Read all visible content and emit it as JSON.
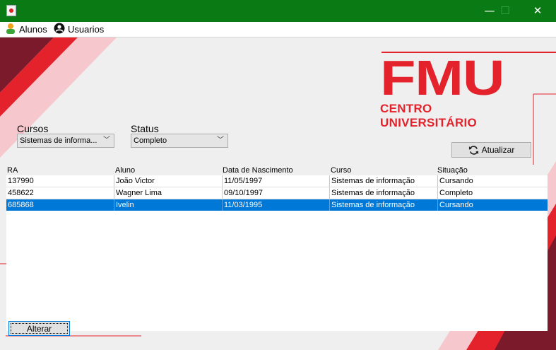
{
  "window": {
    "title": "",
    "controls": {
      "minimize": "—",
      "maximize": "☐",
      "close": "✕"
    }
  },
  "menu": {
    "items": [
      {
        "label": "Alunos",
        "icon": "student-icon"
      },
      {
        "label": "Usuarios",
        "icon": "user-circle-icon"
      }
    ]
  },
  "logo": {
    "main": "FMU",
    "sub": "CENTRO UNIVERSITÁRIO"
  },
  "filters": {
    "cursos": {
      "label": "Cursos",
      "value": "Sistemas de informa..."
    },
    "status": {
      "label": "Status",
      "value": "Completo"
    }
  },
  "buttons": {
    "refresh": "Atualizar",
    "edit": "Alterar"
  },
  "table": {
    "columns": [
      "RA",
      "Aluno",
      "Data de Nascimento",
      "Curso",
      "Situação"
    ],
    "rows": [
      [
        "137990",
        "João Victor",
        "11/05/1997",
        "Sistemas de informação",
        "Cursando"
      ],
      [
        "458622",
        "Wagner Lima",
        "09/10/1997",
        "Sistemas de informação",
        "Completo"
      ],
      [
        "685868",
        "Ivelin",
        "11/03/1995",
        "Sistemas de informação",
        "Cursando"
      ]
    ],
    "selected_row": 2
  },
  "colors": {
    "titlebar": "#0a7a14",
    "brand_red": "#e3222b",
    "dark_red": "#7a1a2a",
    "selection": "#0078d7"
  }
}
